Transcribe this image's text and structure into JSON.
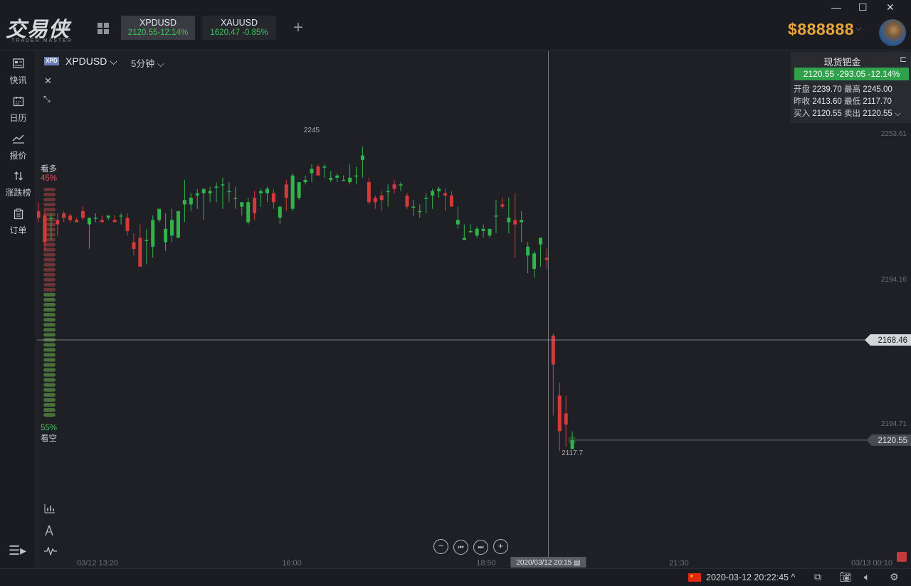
{
  "app": {
    "logo_cn": "交易侠",
    "logo_en": "TRADER MASTER",
    "balance": "$888888"
  },
  "tabs": [
    {
      "symbol": "XPDUSD",
      "quote": "2120.55-12.14%"
    },
    {
      "symbol": "XAUUSD",
      "quote": "1620.47  -0.85%"
    }
  ],
  "window_controls": [
    "—",
    "☐",
    "✕"
  ],
  "sidebar": {
    "items": [
      {
        "label": "快讯",
        "icon": "news-icon"
      },
      {
        "label": "日历",
        "icon": "calendar-icon"
      },
      {
        "label": "报价",
        "icon": "quote-line-icon"
      },
      {
        "label": "涨跌榜",
        "icon": "updown-arrows-icon"
      },
      {
        "label": "订单",
        "icon": "clipboard-icon"
      }
    ]
  },
  "chart_header": {
    "badge": "XPD",
    "symbol": "XPDUSD ⌵",
    "timeframe": "5分钟  ⌵"
  },
  "sentiment": {
    "long_label": "看多",
    "long_pct": "45%",
    "short_label": "看空",
    "short_pct": "55%"
  },
  "quote_panel": {
    "title": "现货钯金",
    "bar": "2120.55  -293.05  -12.14%",
    "open_label": "开盘",
    "open": "2239.70",
    "high_label": "最高",
    "high": "2245.00",
    "prev_label": "昨收",
    "prev": "2413.60",
    "low_label": "最低",
    "low": "2117.70",
    "bid_label": "买入",
    "bid": "2120.55",
    "ask_label": "卖出",
    "ask": "2120.55"
  },
  "crosshair": {
    "price": "2168.46",
    "time": "2020/03/12 20:15 ▤"
  },
  "last_price": "2120.55",
  "status": {
    "datetime": "2020-03-12 20:22:45 ^"
  },
  "chart_data": {
    "type": "candlestick",
    "y_ticks": [
      "2253.61",
      "2194.16",
      "2194.71"
    ],
    "x_ticks": [
      "03/12 13:20",
      "16:00",
      "18:50",
      "21:30",
      "03/13 00:10"
    ],
    "annotations": {
      "high": "2245",
      "low": "2117.7"
    },
    "ylim": [
      2104,
      2262
    ],
    "candles": [
      [
        2224,
        2228,
        2219,
        2221
      ],
      [
        2222,
        2224,
        2206,
        2210
      ],
      [
        2221,
        2223,
        2211,
        2221
      ],
      [
        2220,
        2223,
        2213,
        2218
      ],
      [
        2223,
        2224,
        2219,
        2221
      ],
      [
        2222,
        2223,
        2219,
        2220
      ],
      [
        2220,
        2221,
        2219,
        2219
      ],
      [
        2224,
        2226,
        2220,
        2221
      ],
      [
        2218,
        2221,
        2207,
        2221
      ],
      [
        2221,
        2223,
        2219,
        2221
      ],
      [
        2220,
        2222,
        2219,
        2219
      ],
      [
        2221,
        2222,
        2220,
        2222
      ],
      [
        2220,
        2222,
        2219,
        2219
      ],
      [
        2222,
        2223,
        2218,
        2222
      ],
      [
        2221,
        2223,
        2213,
        2215
      ],
      [
        2210,
        2214,
        2204,
        2207
      ],
      [
        2212,
        2218,
        2199,
        2199
      ],
      [
        2211,
        2216,
        2200,
        2211
      ],
      [
        2208,
        2222,
        2203,
        2220
      ],
      [
        2220,
        2225,
        2219,
        2225
      ],
      [
        2210,
        2223,
        2206,
        2216
      ],
      [
        2213,
        2225,
        2210,
        2220
      ],
      [
        2212,
        2224,
        2212,
        2224
      ],
      [
        2227,
        2238,
        2219,
        2229
      ],
      [
        2227,
        2232,
        2224,
        2230
      ],
      [
        2231,
        2234,
        2225,
        2232
      ],
      [
        2232,
        2234,
        2220,
        2234
      ],
      [
        2232,
        2235,
        2228,
        2233
      ],
      [
        2235,
        2237,
        2228,
        2235
      ],
      [
        2236,
        2239,
        2225,
        2236
      ],
      [
        2233,
        2237,
        2228,
        2233
      ],
      [
        2230,
        2235,
        2225,
        2230
      ],
      [
        2226,
        2228,
        2222,
        2228
      ],
      [
        2219,
        2230,
        2218,
        2228
      ],
      [
        2230,
        2233,
        2220,
        2223
      ],
      [
        2232,
        2234,
        2226,
        2233
      ],
      [
        2232,
        2235,
        2228,
        2234
      ],
      [
        2232,
        2234,
        2225,
        2228
      ],
      [
        2221,
        2226,
        2218,
        2226
      ],
      [
        2236,
        2238,
        2224,
        2230
      ],
      [
        2225,
        2241,
        2224,
        2240
      ],
      [
        2230,
        2236,
        2229,
        2237
      ],
      [
        2237,
        2240,
        2236,
        2238
      ],
      [
        2241,
        2245,
        2237,
        2243
      ],
      [
        2244,
        2245,
        2240,
        2240
      ],
      [
        2244,
        2245,
        2239,
        2244
      ],
      [
        2238,
        2242,
        2237,
        2239
      ],
      [
        2239,
        2241,
        2237,
        2240
      ],
      [
        2238,
        2240,
        2238,
        2238
      ],
      [
        2237,
        2245,
        2236,
        2239
      ],
      [
        2240,
        2244,
        2236,
        2240
      ],
      [
        2247,
        2253,
        2239,
        2249
      ],
      [
        2237,
        2239,
        2227,
        2228
      ],
      [
        2230,
        2231,
        2225,
        2228
      ],
      [
        2231,
        2233,
        2224,
        2229
      ],
      [
        2233,
        2236,
        2226,
        2233
      ],
      [
        2236,
        2238,
        2232,
        2234
      ],
      [
        2236,
        2237,
        2233,
        2236
      ],
      [
        2231,
        2232,
        2225,
        2226
      ],
      [
        2226,
        2229,
        2222,
        2226
      ],
      [
        2224,
        2227,
        2221,
        2224
      ],
      [
        2230,
        2232,
        2223,
        2230
      ],
      [
        2231,
        2234,
        2225,
        2233
      ],
      [
        2233,
        2235,
        2230,
        2234
      ],
      [
        2232,
        2234,
        2224,
        2231
      ],
      [
        2231,
        2233,
        2226,
        2226
      ],
      [
        2218,
        2226,
        2216,
        2220
      ],
      [
        2211,
        2218,
        2211,
        2212
      ],
      [
        2215,
        2218,
        2214,
        2215
      ],
      [
        2213,
        2217,
        2212,
        2216
      ],
      [
        2215,
        2218,
        2212,
        2216
      ],
      [
        2213,
        2216,
        2212,
        2216
      ],
      [
        2222,
        2229,
        2214,
        2222
      ],
      [
        2227,
        2230,
        2225,
        2226
      ],
      [
        2219,
        2230,
        2214,
        2221
      ],
      [
        2220,
        2232,
        2203,
        2218
      ],
      [
        2219,
        2224,
        2210,
        2220
      ],
      [
        2204,
        2210,
        2196,
        2208
      ],
      [
        2198,
        2206,
        2194,
        2205
      ],
      [
        2209,
        2212,
        2199,
        2212
      ],
      [
        2203,
        2207,
        2198,
        2202
      ],
      [
        2168,
        2169,
        2132,
        2155
      ],
      [
        2141,
        2147,
        2116,
        2125
      ],
      [
        2133,
        2141,
        2118,
        2128
      ],
      [
        2117,
        2125,
        2117,
        2121
      ]
    ]
  }
}
